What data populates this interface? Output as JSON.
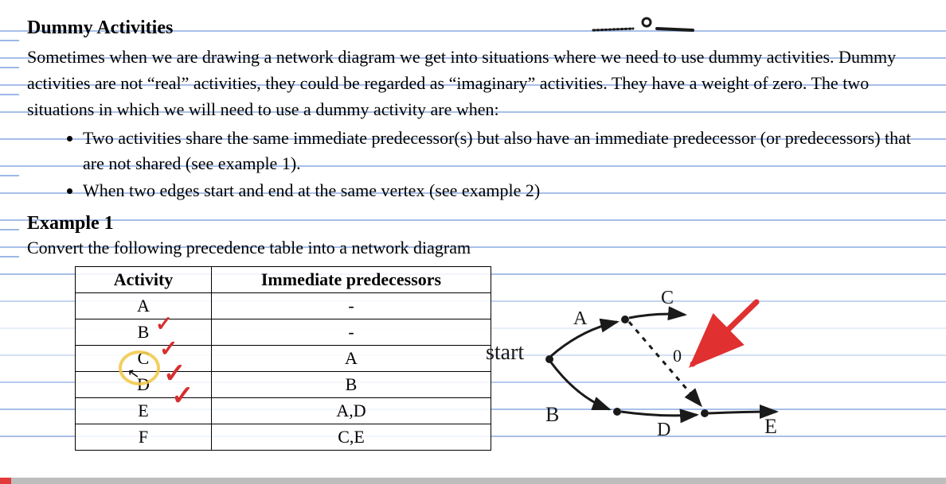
{
  "title": "Dummy Activities",
  "para": "Sometimes when we are drawing a network diagram we get into situations where we need to use dummy activities. Dummy activities are not “real” activities, they could be regarded as “imaginary” activities. They have a weight of zero. The two situations in which we will need to use a dummy activity are when:",
  "bullet1": "Two activities share the same immediate predecessor(s) but also have an immediate predecessor (or predecessors) that are not shared (see example 1).",
  "bullet2": "When two edges start and end at the same vertex (see example 2)",
  "example_title": "Example 1",
  "example_sub": "Convert the following precedence table into a network diagram",
  "table": {
    "head_activity": "Activity",
    "head_pred": "Immediate predecessors",
    "rows": [
      {
        "activity": "A",
        "pred": "-"
      },
      {
        "activity": "B",
        "pred": "-"
      },
      {
        "activity": "C",
        "pred": "A"
      },
      {
        "activity": "D",
        "pred": "B"
      },
      {
        "activity": "E",
        "pred": "A,D"
      },
      {
        "activity": "F",
        "pred": "C,E"
      }
    ]
  },
  "diagram": {
    "start_label": "start",
    "labels": {
      "A": "A",
      "B": "B",
      "C": "C",
      "D": "D",
      "E": "E",
      "zero": "0"
    }
  },
  "checks": [
    "A",
    "B",
    "C",
    "D"
  ],
  "pen_marker": "o",
  "progress_percent": 1.2
}
